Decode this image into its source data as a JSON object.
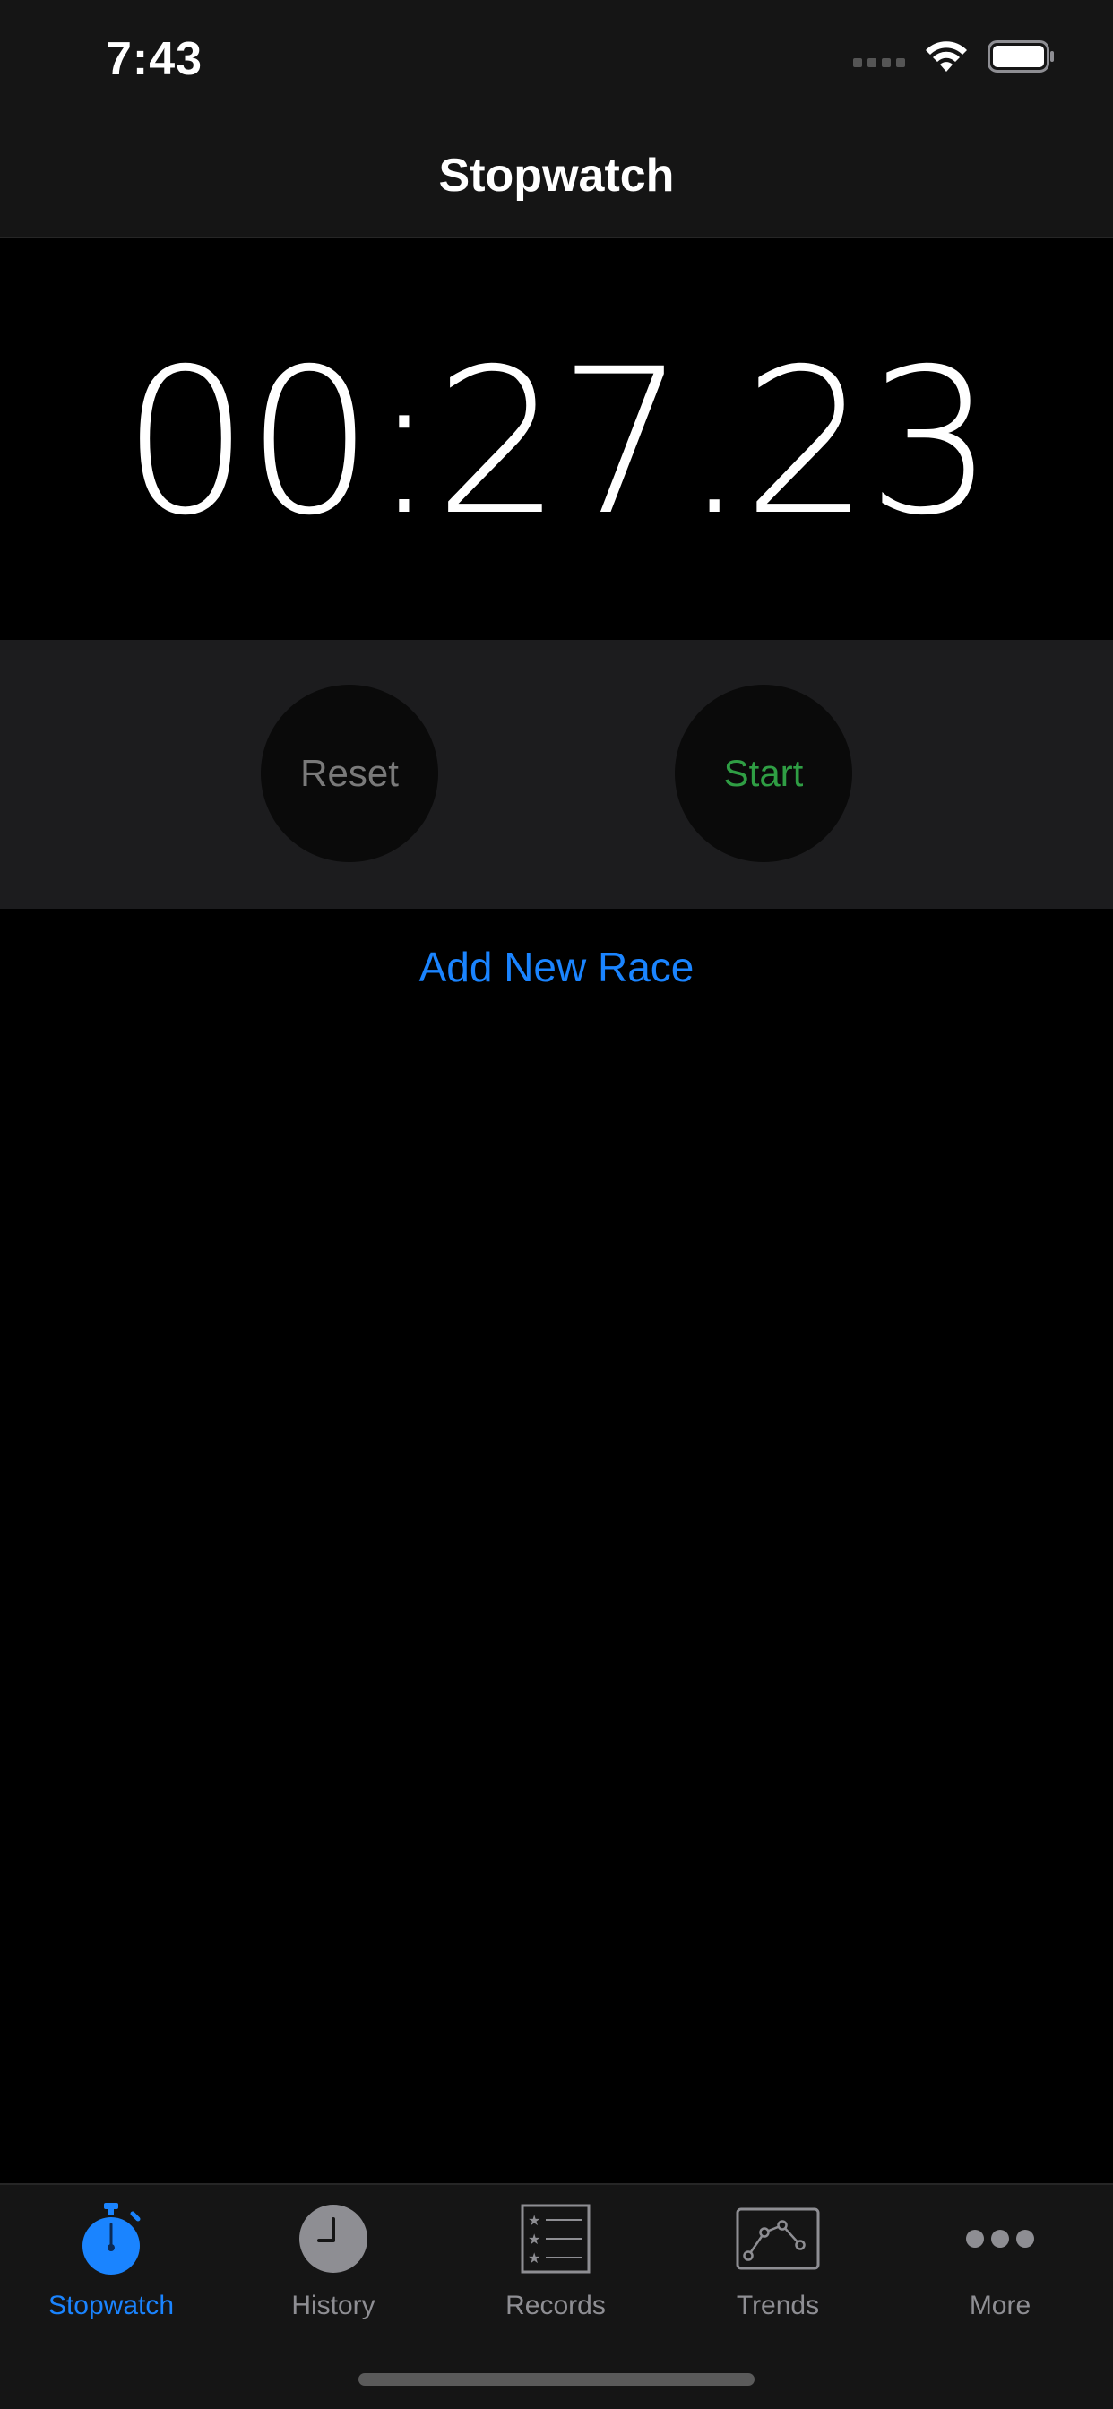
{
  "status_bar": {
    "time": "7:43"
  },
  "nav": {
    "title": "Stopwatch"
  },
  "timer": {
    "display": "00:27.23"
  },
  "controls": {
    "reset_label": "Reset",
    "start_label": "Start"
  },
  "add_race_label": "Add New Race",
  "tabs": [
    {
      "label": "Stopwatch",
      "icon": "stopwatch-icon",
      "active": true
    },
    {
      "label": "History",
      "icon": "clock-icon",
      "active": false
    },
    {
      "label": "Records",
      "icon": "star-list-icon",
      "active": false
    },
    {
      "label": "Trends",
      "icon": "line-chart-icon",
      "active": false
    },
    {
      "label": "More",
      "icon": "more-dots-icon",
      "active": false
    }
  ],
  "colors": {
    "accent": "#1a84ff",
    "start_green": "#2f9e44",
    "inactive": "#8e8e93",
    "bar_bg": "#151515",
    "controls_bg": "#1c1c1e"
  }
}
